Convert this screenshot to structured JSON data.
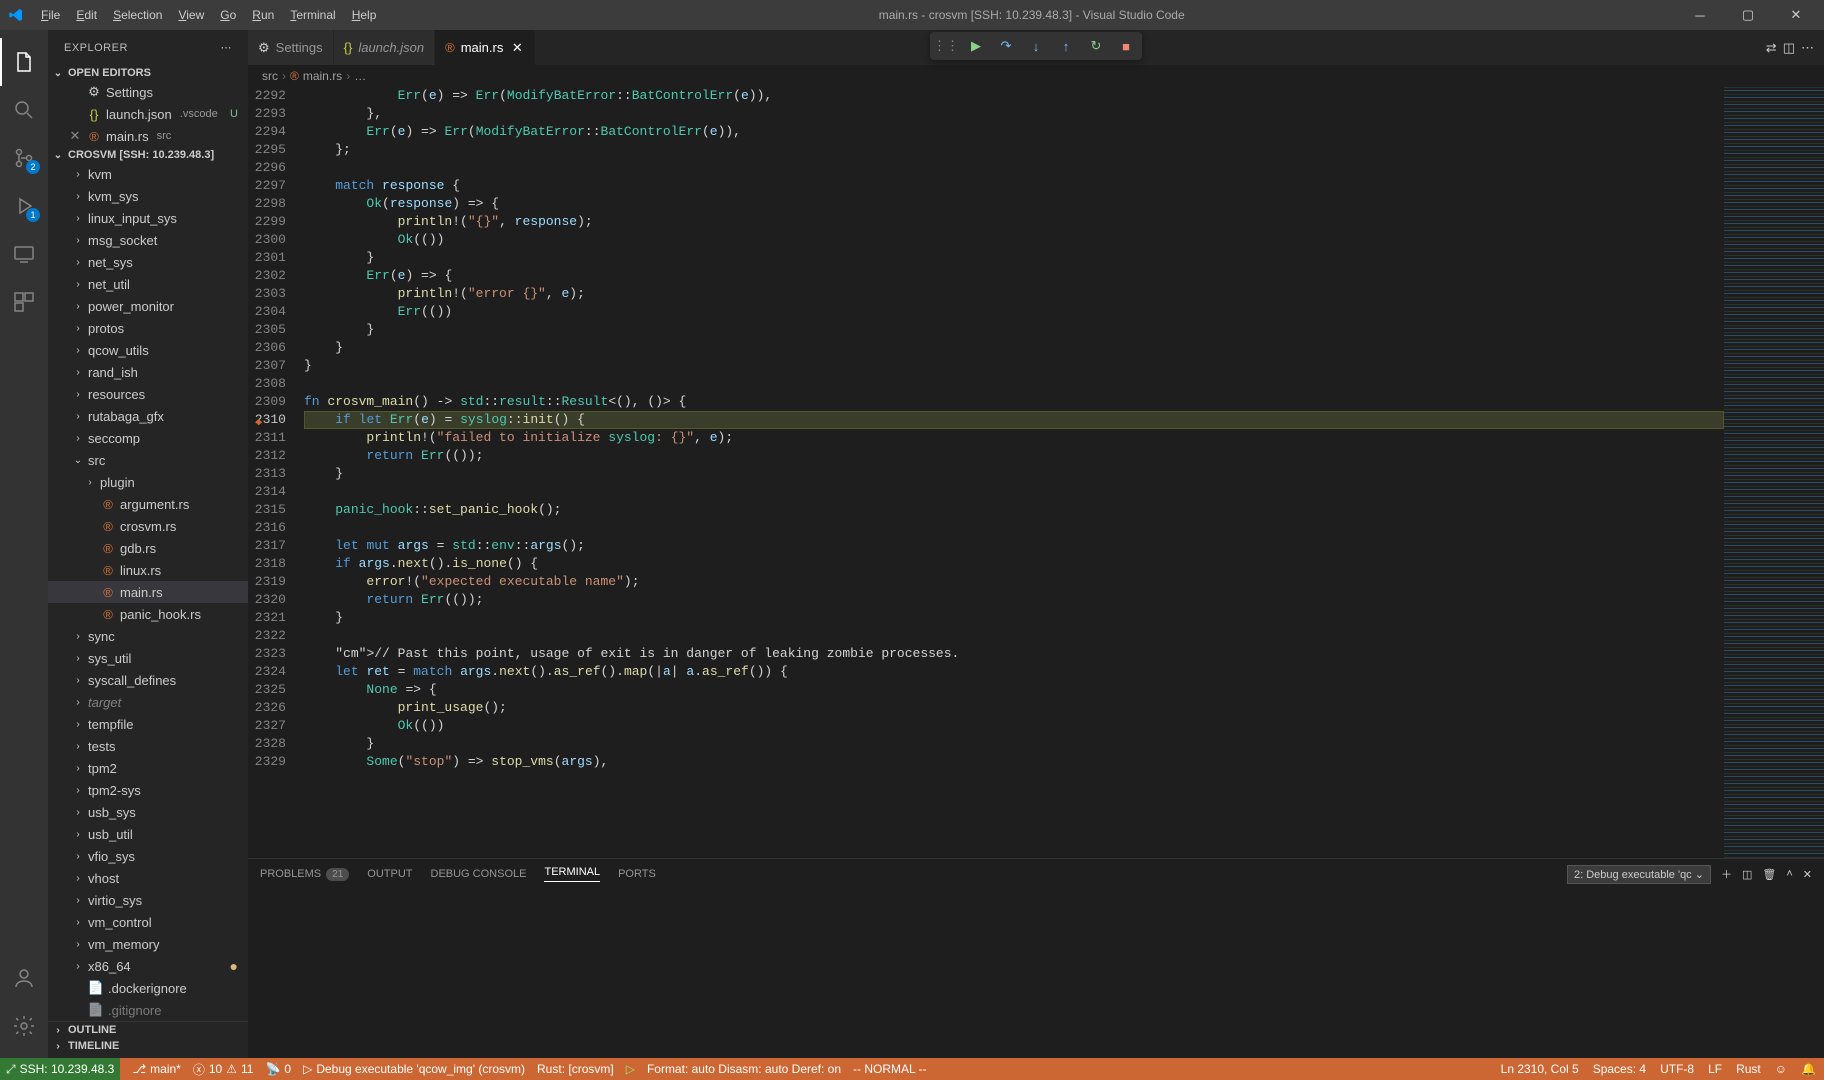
{
  "title": "main.rs - crosvm [SSH: 10.239.48.3] - Visual Studio Code",
  "menu": [
    "File",
    "Edit",
    "Selection",
    "View",
    "Go",
    "Run",
    "Terminal",
    "Help"
  ],
  "activity": {
    "scm_badge": "2",
    "debug_badge": "1"
  },
  "sidebar": {
    "title": "EXPLORER",
    "openEditors": "OPEN EDITORS",
    "workspace": "CROSVM [SSH: 10.239.48.3]",
    "outline": "OUTLINE",
    "timeline": "TIMELINE",
    "editors": [
      {
        "name": "Settings",
        "icon": "gear"
      },
      {
        "name": "launch.json",
        "trail": ".vscode",
        "status": "U",
        "icon": "json"
      },
      {
        "name": "main.rs",
        "trail": "src",
        "icon": "rust",
        "close": true
      }
    ],
    "tree": [
      {
        "d": 1,
        "t": "kvm",
        "k": "folder"
      },
      {
        "d": 1,
        "t": "kvm_sys",
        "k": "folder"
      },
      {
        "d": 1,
        "t": "linux_input_sys",
        "k": "folder"
      },
      {
        "d": 1,
        "t": "msg_socket",
        "k": "folder"
      },
      {
        "d": 1,
        "t": "net_sys",
        "k": "folder"
      },
      {
        "d": 1,
        "t": "net_util",
        "k": "folder"
      },
      {
        "d": 1,
        "t": "power_monitor",
        "k": "folder"
      },
      {
        "d": 1,
        "t": "protos",
        "k": "folder"
      },
      {
        "d": 1,
        "t": "qcow_utils",
        "k": "folder"
      },
      {
        "d": 1,
        "t": "rand_ish",
        "k": "folder"
      },
      {
        "d": 1,
        "t": "resources",
        "k": "folder"
      },
      {
        "d": 1,
        "t": "rutabaga_gfx",
        "k": "folder"
      },
      {
        "d": 1,
        "t": "seccomp",
        "k": "folder"
      },
      {
        "d": 1,
        "t": "src",
        "k": "folder-open"
      },
      {
        "d": 2,
        "t": "plugin",
        "k": "folder"
      },
      {
        "d": 2,
        "t": "argument.rs",
        "k": "rust"
      },
      {
        "d": 2,
        "t": "crosvm.rs",
        "k": "rust"
      },
      {
        "d": 2,
        "t": "gdb.rs",
        "k": "rust"
      },
      {
        "d": 2,
        "t": "linux.rs",
        "k": "rust"
      },
      {
        "d": 2,
        "t": "main.rs",
        "k": "rust",
        "sel": true
      },
      {
        "d": 2,
        "t": "panic_hook.rs",
        "k": "rust"
      },
      {
        "d": 1,
        "t": "sync",
        "k": "folder"
      },
      {
        "d": 1,
        "t": "sys_util",
        "k": "folder"
      },
      {
        "d": 1,
        "t": "syscall_defines",
        "k": "folder"
      },
      {
        "d": 1,
        "t": "target",
        "k": "folder",
        "fade": true
      },
      {
        "d": 1,
        "t": "tempfile",
        "k": "folder"
      },
      {
        "d": 1,
        "t": "tests",
        "k": "folder"
      },
      {
        "d": 1,
        "t": "tpm2",
        "k": "folder"
      },
      {
        "d": 1,
        "t": "tpm2-sys",
        "k": "folder"
      },
      {
        "d": 1,
        "t": "usb_sys",
        "k": "folder"
      },
      {
        "d": 1,
        "t": "usb_util",
        "k": "folder"
      },
      {
        "d": 1,
        "t": "vfio_sys",
        "k": "folder"
      },
      {
        "d": 1,
        "t": "vhost",
        "k": "folder"
      },
      {
        "d": 1,
        "t": "virtio_sys",
        "k": "folder"
      },
      {
        "d": 1,
        "t": "vm_control",
        "k": "folder"
      },
      {
        "d": 1,
        "t": "vm_memory",
        "k": "folder"
      },
      {
        "d": 1,
        "t": "x86_64",
        "k": "folder",
        "mod": true
      },
      {
        "d": 1,
        "t": ".dockerignore",
        "k": "file"
      },
      {
        "d": 1,
        "t": ".gitignore",
        "k": "file",
        "cut": true
      }
    ]
  },
  "tabs": [
    {
      "label": "Settings",
      "icon": "gear"
    },
    {
      "label": "launch.json",
      "icon": "json",
      "italic": true
    },
    {
      "label": "main.rs",
      "icon": "rust",
      "active": true
    }
  ],
  "breadcrumbs": [
    "src",
    "main.rs",
    "…"
  ],
  "lines": {
    "start": 2292,
    "count": 38,
    "bp_line": 2310
  },
  "code": [
    "            Err(e) => Err(ModifyBatError::BatControlErr(e)),",
    "        },",
    "        Err(e) => Err(ModifyBatError::BatControlErr(e)),",
    "    };",
    "",
    "    match response {",
    "        Ok(response) => {",
    "            println!(\"{}\", response);",
    "            Ok(())",
    "        }",
    "        Err(e) => {",
    "            println!(\"error {}\", e);",
    "            Err(())",
    "        }",
    "    }",
    "}",
    "",
    "fn crosvm_main() -> std::result::Result<(), ()> {",
    "    if let Err(e) = syslog::init() {",
    "        println!(\"failed to initialize syslog: {}\", e);",
    "        return Err(());",
    "    }",
    "",
    "    panic_hook::set_panic_hook();",
    "",
    "    let mut args = std::env::args();",
    "    if args.next().is_none() {",
    "        error!(\"expected executable name\");",
    "        return Err(());",
    "    }",
    "",
    "    // Past this point, usage of exit is in danger of leaking zombie processes.",
    "    let ret = match args.next().as_ref().map(|a| a.as_ref()) {",
    "        None => {",
    "            print_usage();",
    "            Ok(())",
    "        }",
    "        Some(\"stop\") => stop_vms(args),"
  ],
  "panel": {
    "tabs": {
      "problems": "PROBLEMS",
      "output": "OUTPUT",
      "debug": "DEBUG CONSOLE",
      "terminal": "TERMINAL",
      "ports": "PORTS"
    },
    "problems_count": "21",
    "term_name": "2: Debug executable 'qc"
  },
  "status": {
    "remote": "SSH: 10.239.48.3",
    "branch": "main*",
    "errors": "10",
    "warnings": "11",
    "radio": "0",
    "debug": "Debug executable 'qcow_img' (crosvm)",
    "rust": "Rust: [crosvm]",
    "format": "Format: auto  Disasm: auto  Deref: on",
    "vim": "-- NORMAL --",
    "pos": "Ln 2310, Col 5",
    "spaces": "Spaces: 4",
    "enc": "UTF-8",
    "eol": "LF",
    "lang": "Rust"
  }
}
